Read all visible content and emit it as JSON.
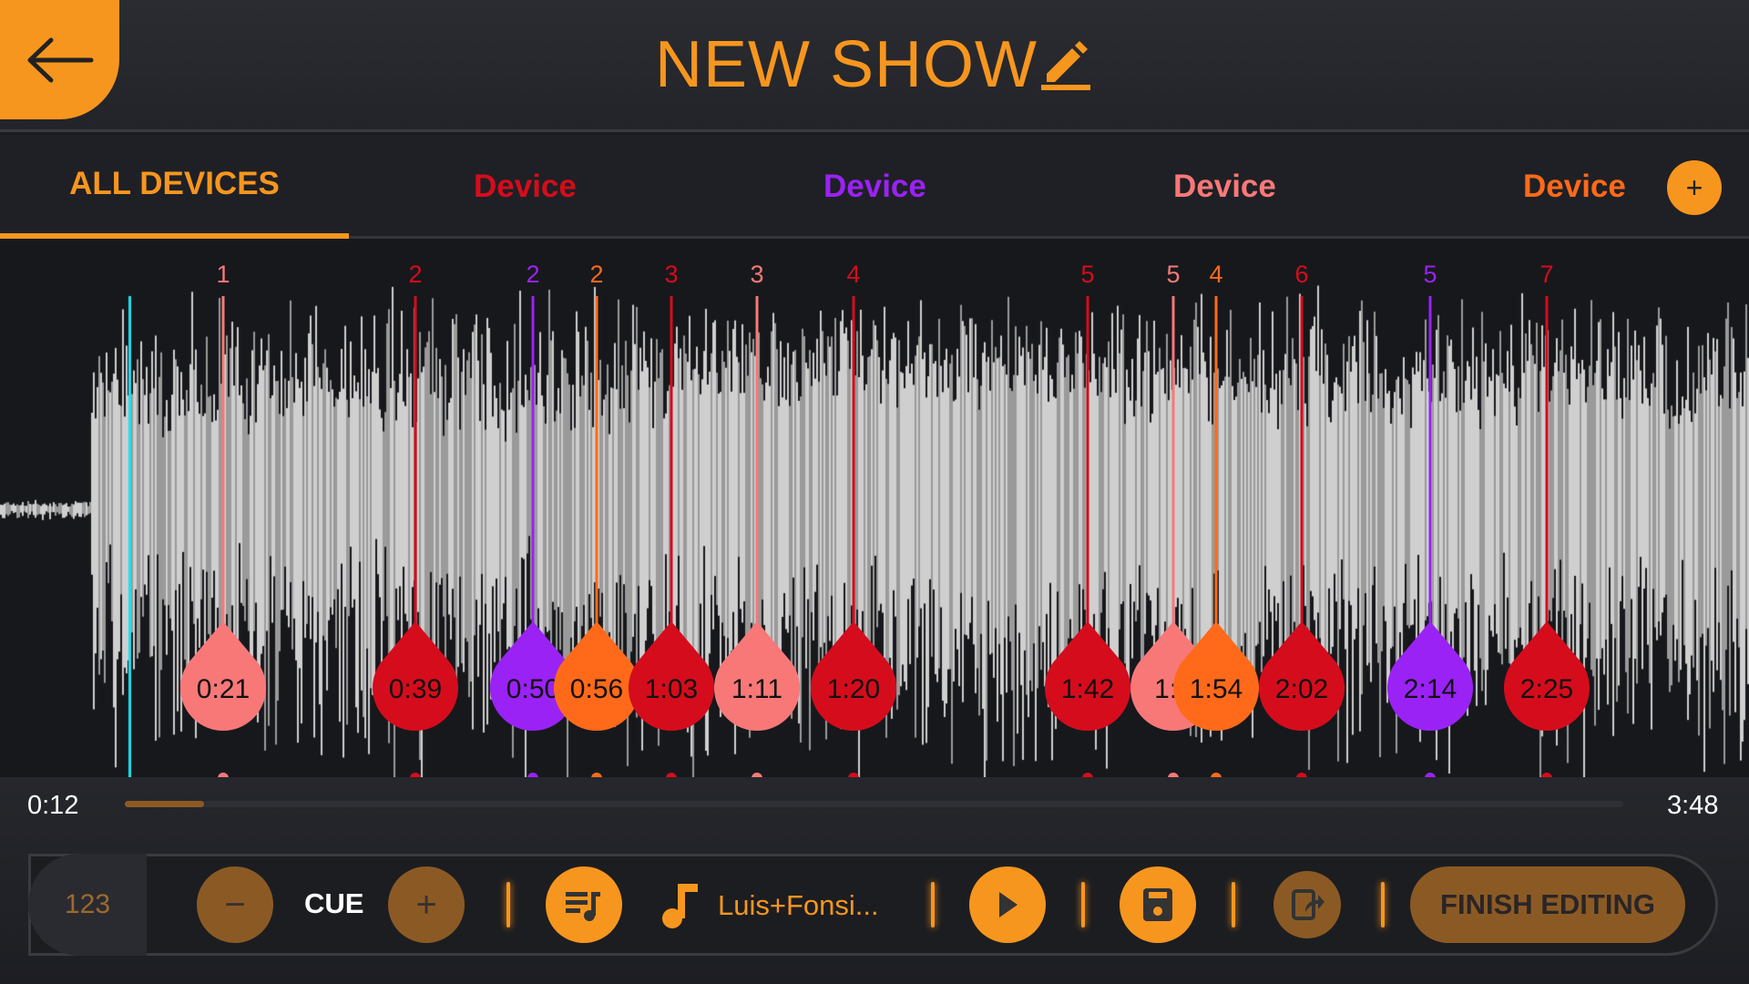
{
  "header": {
    "title": "NEW SHOW",
    "back_icon": "arrow-left-icon",
    "edit_icon": "pencil-icon"
  },
  "colors": {
    "accent": "#f7961e",
    "red": "#d50c1c",
    "pink": "#f87878",
    "orange": "#ff6a1a",
    "purple": "#9a22f5",
    "playhead": "#1ee0f0"
  },
  "tabs": [
    {
      "label": "ALL DEVICES",
      "color": "#f7961e",
      "active": true
    },
    {
      "label": "Device",
      "color": "#d50c1c"
    },
    {
      "label": "Device",
      "color": "#9a22f5"
    },
    {
      "label": "Device",
      "color": "#f87878"
    },
    {
      "label": "Device",
      "color": "#ff6a1a"
    }
  ],
  "add_tab_label": "+",
  "cues": [
    {
      "number": "1",
      "time": "0:21",
      "color": "pink"
    },
    {
      "number": "2",
      "time": "0:39",
      "color": "red"
    },
    {
      "number": "2",
      "time": "0:50",
      "color": "purple"
    },
    {
      "number": "2",
      "time": "0:56",
      "color": "orange"
    },
    {
      "number": "3",
      "time": "1:03",
      "color": "red"
    },
    {
      "number": "3",
      "time": "1:11",
      "color": "pink"
    },
    {
      "number": "4",
      "time": "1:20",
      "color": "red"
    },
    {
      "number": "5",
      "time": "1:42",
      "color": "red"
    },
    {
      "number": "5",
      "time": "1:5",
      "color": "pink"
    },
    {
      "number": "4",
      "time": "1:54",
      "color": "orange"
    },
    {
      "number": "6",
      "time": "2:02",
      "color": "red"
    },
    {
      "number": "5",
      "time": "2:14",
      "color": "purple"
    },
    {
      "number": "7",
      "time": "2:25",
      "color": "red"
    }
  ],
  "playback": {
    "current": "0:12",
    "total": "3:48",
    "progress_percent": 5.3
  },
  "toolbar": {
    "number_placeholder": "123",
    "cue_label": "CUE",
    "minus": "−",
    "plus": "+",
    "song": "Luis+Fonsi...",
    "finish_label": "FINISH EDITING"
  }
}
